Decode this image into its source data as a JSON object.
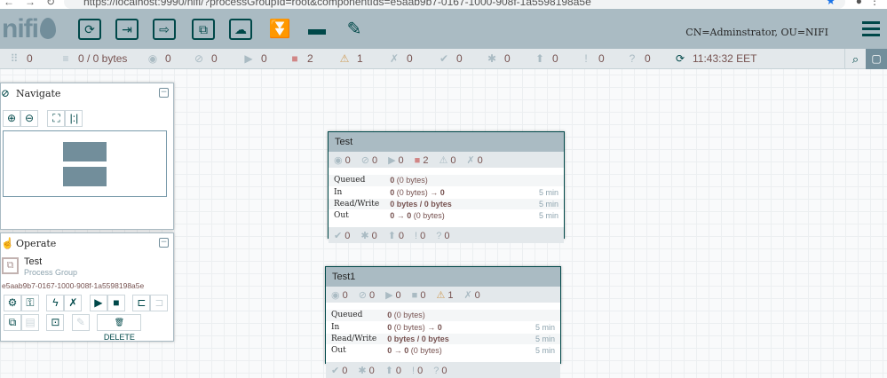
{
  "browser": {
    "url": "https://localhost:9990/nifi/?processGroupId=root&componentIds=e5aab9b7-0167-1000-908f-1a5598198a5e"
  },
  "header": {
    "logo": "nifi",
    "user": "CN=Adminstrator, OU=NIFI",
    "tools": [
      {
        "name": "processor",
        "icon": "⟳"
      },
      {
        "name": "input-port",
        "icon": "⇥"
      },
      {
        "name": "output-port",
        "icon": "⇨"
      },
      {
        "name": "process-group",
        "icon": "⧉"
      },
      {
        "name": "remote-process-group",
        "icon": "☁"
      },
      {
        "name": "funnel",
        "icon": "⏬"
      },
      {
        "name": "template",
        "icon": "▬"
      },
      {
        "name": "label",
        "icon": "✎"
      }
    ]
  },
  "status": [
    {
      "name": "active-threads",
      "icon": "⠿",
      "value": "0"
    },
    {
      "name": "queued",
      "icon": "≡",
      "value": "0 / 0 bytes"
    },
    {
      "name": "transmitting",
      "icon": "◉",
      "value": "0"
    },
    {
      "name": "not-transmitting",
      "icon": "⊘",
      "value": "0"
    },
    {
      "name": "running",
      "icon": "▶",
      "value": "0"
    },
    {
      "name": "stopped",
      "icon": "■",
      "value": "2",
      "color": "#d18686"
    },
    {
      "name": "invalid",
      "icon": "⚠",
      "value": "1",
      "color": "#cf9f5d"
    },
    {
      "name": "disabled",
      "icon": "✗",
      "value": "0"
    },
    {
      "name": "up-to-date",
      "icon": "✔",
      "value": "0"
    },
    {
      "name": "locally-modified",
      "icon": "✱",
      "value": "0"
    },
    {
      "name": "stale",
      "icon": "⬆",
      "value": "0"
    },
    {
      "name": "sync-failure",
      "icon": "!",
      "value": "0"
    },
    {
      "name": "unknown",
      "icon": "?",
      "value": "0"
    },
    {
      "name": "refresh",
      "icon": "⟳",
      "value": "11:43:32 EET"
    }
  ],
  "navigate": {
    "title": "Navigate"
  },
  "operate": {
    "title": "Operate",
    "component_name": "Test",
    "component_type": "Process Group",
    "component_id": "e5aab9b7-0167-1000-908f-1a5598198a5e",
    "delete_label": "DELETE"
  },
  "groups": [
    {
      "name": "Test",
      "stats": [
        "0",
        "0",
        "0",
        "2",
        "0",
        "0"
      ],
      "queued_count": "0",
      "queued_size": "(0 bytes)",
      "in_count": "0",
      "in_size": "(0 bytes)",
      "in_ports": "→ 0",
      "readwrite": "0 bytes / 0 bytes",
      "out_ports": "0 →",
      "out_count": "0",
      "out_size": "(0 bytes)",
      "time": "5 min",
      "footer": [
        "0",
        "0",
        "0",
        "0",
        "0"
      ]
    },
    {
      "name": "Test1",
      "stats": [
        "0",
        "0",
        "0",
        "0",
        "1",
        "0"
      ],
      "queued_count": "0",
      "queued_size": "(0 bytes)",
      "in_count": "0",
      "in_size": "(0 bytes)",
      "in_ports": "→ 0",
      "readwrite": "0 bytes / 0 bytes",
      "out_ports": "0 →",
      "out_count": "0",
      "out_size": "(0 bytes)",
      "time": "5 min",
      "footer": [
        "0",
        "0",
        "0",
        "0",
        "0"
      ]
    }
  ],
  "labels": {
    "queued": "Queued",
    "in": "In",
    "readwrite": "Read/Write",
    "out": "Out"
  }
}
